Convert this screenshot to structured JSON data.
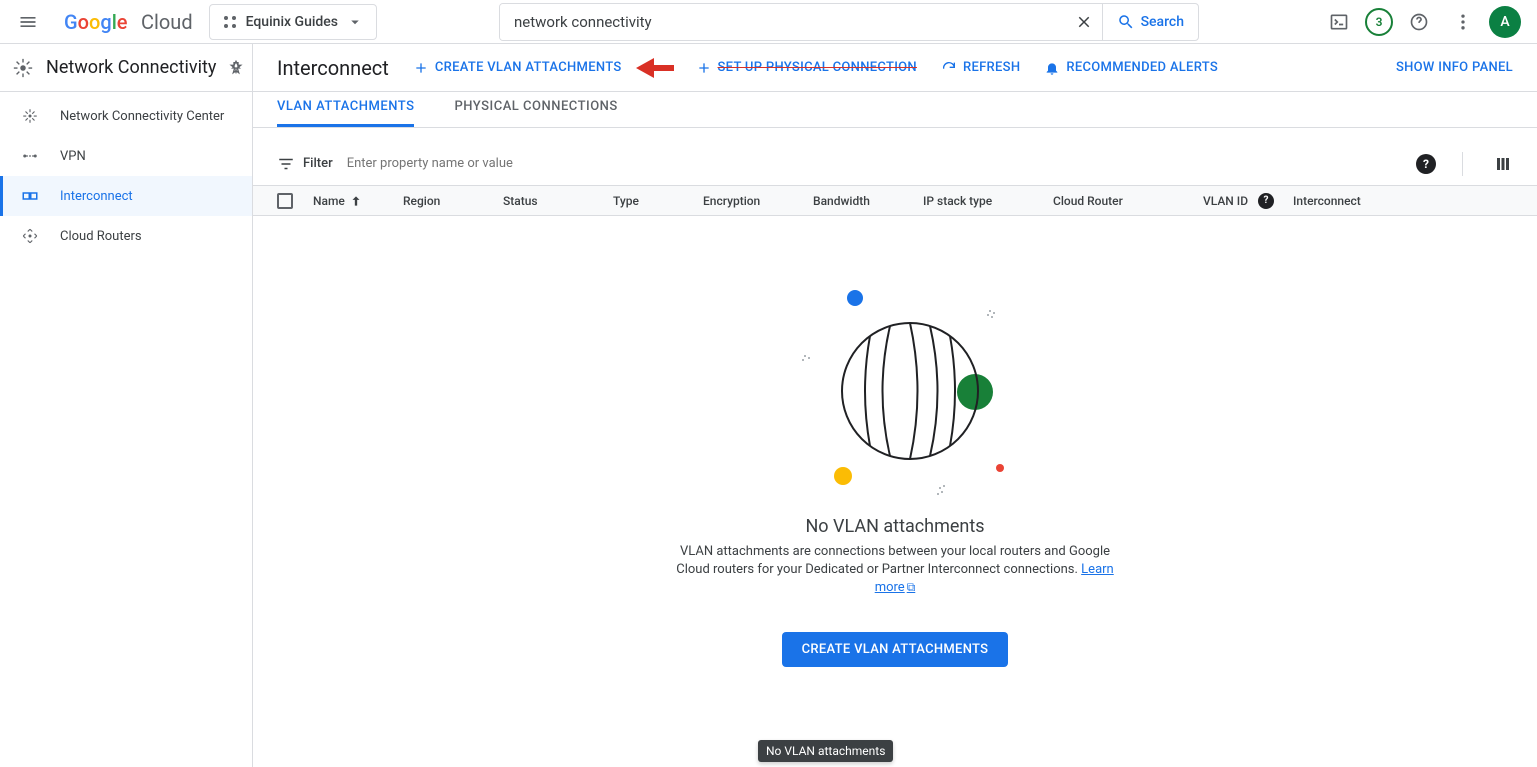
{
  "header": {
    "logo_text": "Cloud",
    "project_name": "Equinix Guides",
    "search_value": "network connectivity",
    "search_button": "Search",
    "trial_badge": "3",
    "avatar_letter": "A"
  },
  "sidebar": {
    "title": "Network Connectivity",
    "items": [
      {
        "label": "Network Connectivity Center"
      },
      {
        "label": "VPN"
      },
      {
        "label": "Interconnect"
      },
      {
        "label": "Cloud Routers"
      }
    ]
  },
  "page": {
    "title": "Interconnect",
    "actions": {
      "create_vlan": "CREATE VLAN ATTACHMENTS",
      "setup_physical": "SET UP PHYSICAL CONNECTION",
      "refresh": "REFRESH",
      "recommended_alerts": "RECOMMENDED ALERTS"
    },
    "info_panel": "SHOW INFO PANEL"
  },
  "tabs": [
    {
      "label": "VLAN ATTACHMENTS"
    },
    {
      "label": "PHYSICAL CONNECTIONS"
    }
  ],
  "filter": {
    "label": "Filter",
    "placeholder": "Enter property name or value"
  },
  "table": {
    "columns": {
      "name": "Name",
      "region": "Region",
      "status": "Status",
      "type": "Type",
      "encryption": "Encryption",
      "bandwidth": "Bandwidth",
      "ip_stack": "IP stack type",
      "cloud_router": "Cloud Router",
      "vlan_id": "VLAN ID",
      "interconnect": "Interconnect"
    }
  },
  "empty": {
    "tooltip": "No VLAN attachments",
    "title": "No VLAN attachments",
    "desc_before": "VLAN attachments are connections between your local routers and Google Cloud routers for your Dedicated or Partner Interconnect connections. ",
    "learn_more": "Learn more",
    "button": "CREATE VLAN ATTACHMENTS"
  }
}
